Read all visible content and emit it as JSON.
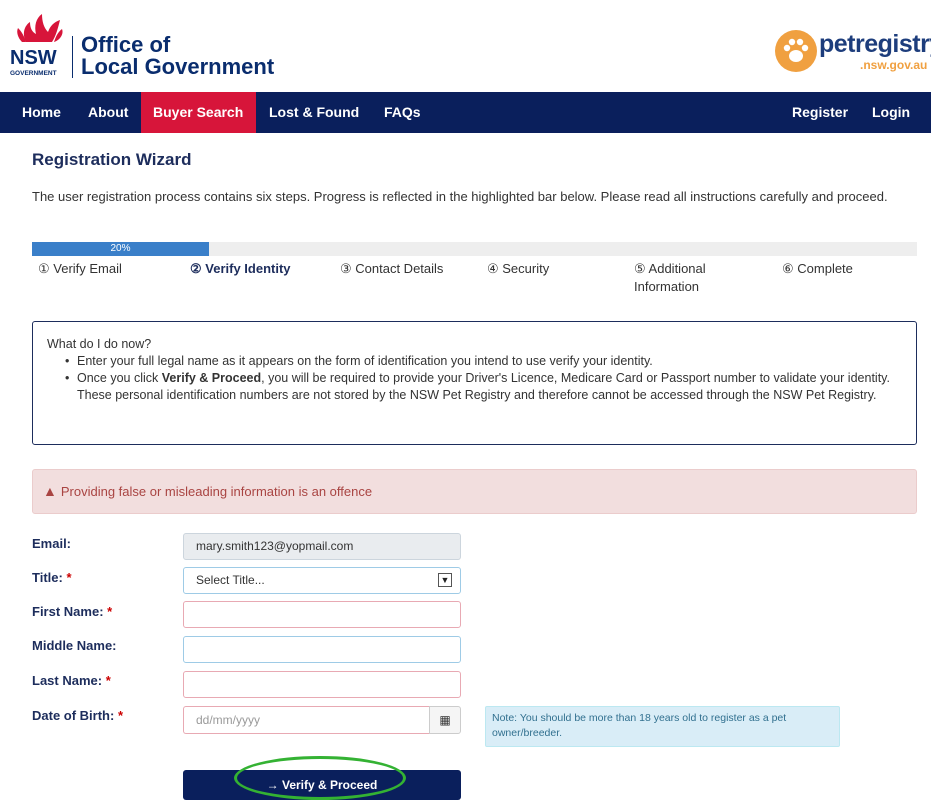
{
  "header": {
    "gov_logo_text": "NSW",
    "gov_logo_sub": "GOVERNMENT",
    "org_line1": "Office of",
    "org_line2": "Local Government",
    "pet_logo_name": "petregistry",
    "pet_logo_domain": ".nsw.gov.au"
  },
  "nav": {
    "items": [
      {
        "label": "Home"
      },
      {
        "label": "About"
      },
      {
        "label": "Buyer Search"
      },
      {
        "label": "Lost & Found"
      },
      {
        "label": "FAQs"
      }
    ],
    "register": "Register",
    "login": "Login",
    "active_color": "#d7153a",
    "bar_color": "#0a1f5c"
  },
  "wizard": {
    "title": "Registration Wizard",
    "intro": "The user registration process contains six steps. Progress is reflected in the highlighted bar below. Please read all instructions carefully and proceed.",
    "progress_label": "20%",
    "progress_value": 0.2,
    "steps": [
      {
        "label": "① Verify Email"
      },
      {
        "label": "② Verify Identity"
      },
      {
        "label": "③ Contact Details"
      },
      {
        "label": "④ Security"
      },
      {
        "label": "⑤ Additional Information"
      },
      {
        "label": "⑥ Complete"
      }
    ]
  },
  "help": {
    "heading": "What do I do now?",
    "bullet1": "Enter your full legal name as it appears on the form of identification you intend to use verify your identity.",
    "bullet2_pre": "Once you click ",
    "bullet2_bold": "Verify & Proceed",
    "bullet2_post": ", you will be required to provide your Driver's Licence, Medicare Card or Passport number to validate your identity. These personal identification numbers are not stored by the NSW Pet Registry and therefore cannot be accessed through the NSW Pet Registry."
  },
  "alert": {
    "icon": "warning-triangle-icon",
    "text": "Providing false or misleading information is an offence"
  },
  "form": {
    "email_label": "Email:",
    "email_value": "mary.smith123@yopmail.com",
    "title_label": "Title:",
    "title_value": "Select Title...",
    "first_label": "First Name:",
    "middle_label": "Middle Name:",
    "last_label": "Last Name:",
    "dob_label": "Date of Birth:",
    "dob_placeholder": "dd/mm/yyyy",
    "required_mark": "*",
    "dob_note": "Note: You should be more than 18 years old to register as a pet owner/breeder.",
    "submit_label": "→ Verify & Proceed"
  }
}
